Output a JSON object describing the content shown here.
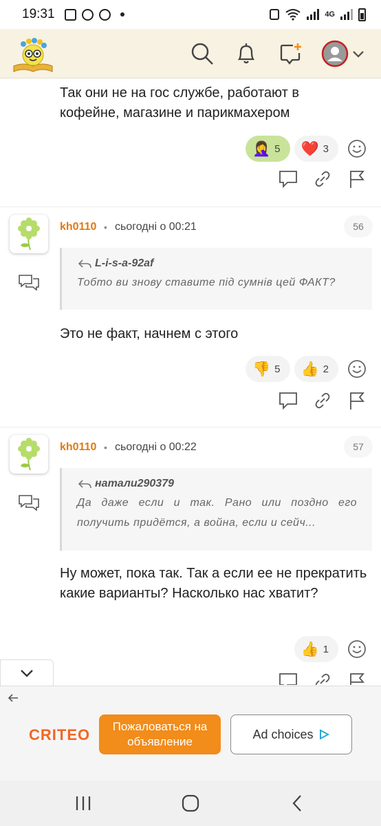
{
  "status_bar": {
    "time": "19:31",
    "network_label": "4G"
  },
  "app_bar": {
    "icons": [
      "search-icon",
      "bell-icon",
      "new-message-icon",
      "user-avatar-icon",
      "chevron-down-icon"
    ],
    "accent": "#f7f2e2"
  },
  "comments": [
    {
      "text": "Так они не на гос службе, работают в кофейне, магазине и парикмахером",
      "reactions": [
        {
          "emoji": "🤦‍♀️",
          "count": "5",
          "active": true
        },
        {
          "emoji": "❤️",
          "count": "3",
          "active": false
        }
      ]
    },
    {
      "author": "kh0110",
      "separator": "•",
      "time": "сьогодні о 00:21",
      "number": "56",
      "quote_author": "L-i-s-a-92af",
      "quote_text": "Тобто ви знову ставите під сумнів цей ФАКТ?",
      "text": "Это не факт, начнем с этого",
      "reactions": [
        {
          "emoji": "👎",
          "count": "5",
          "active": false
        },
        {
          "emoji": "👍",
          "count": "2",
          "active": false
        }
      ]
    },
    {
      "author": "kh0110",
      "separator": "•",
      "time": "сьогодні о 00:22",
      "number": "57",
      "quote_author": "натали290379",
      "quote_text": "Да даже если и так. Рано или поздно его получить придётся, а война, если и сейч...",
      "text": "Ну может, пока так. Так а если ее не прекратить какие варианты? Насколько нас хватит?",
      "reactions": [
        {
          "emoji": "👍",
          "count": "1",
          "active": false
        }
      ]
    }
  ],
  "ad": {
    "brand": "CRITEO",
    "report_label": "Пожаловаться на объявление",
    "ad_choices_label": "Ad choices",
    "brand_color": "#f26622",
    "button_color": "#f28c1a"
  }
}
